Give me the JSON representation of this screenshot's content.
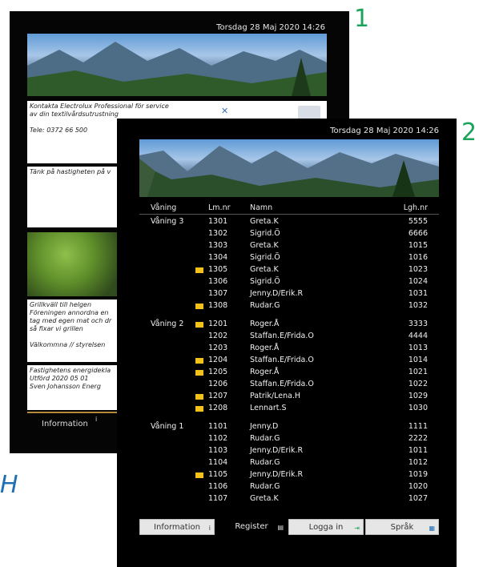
{
  "labels": {
    "one": "1",
    "two": "2",
    "side_letter": "H"
  },
  "screen1": {
    "datetime": "Torsdag 28 Maj 2020  14:26",
    "panel1": [
      "Kontakta Electrolux Professional för service",
      "av din textilvårdsutrustning",
      "",
      "Tele: 0372 66 500"
    ],
    "panel2": [
      "Tänk på hastigheten på v"
    ],
    "panel3": [
      "Grillkväll till helgen",
      "Föreningen annordna en",
      "tag med egen mat och dr",
      "så fixar vi grillen",
      "",
      "Välkommna  // styrelsen"
    ],
    "panel4": [
      "Fastighetens energidekla",
      "Utförd 2020 05 01",
      "Sven Johansson Energ"
    ],
    "info_button": "Information",
    "info_icon": "i"
  },
  "screen2": {
    "datetime": "Torsdag 28 Maj 2020  14:26",
    "headers": {
      "floor": "Våning",
      "lm": "Lm.nr",
      "name": "Namn",
      "lgh": "Lgh.nr"
    },
    "rows": [
      {
        "floor": "Våning 3",
        "mail": false,
        "lm": "1301",
        "name": "Greta.K",
        "lgh": "5555"
      },
      {
        "floor": "",
        "mail": false,
        "lm": "1302",
        "name": "Sigrid.Ö",
        "lgh": "6666"
      },
      {
        "floor": "",
        "mail": false,
        "lm": "1303",
        "name": "Greta.K",
        "lgh": "1015"
      },
      {
        "floor": "",
        "mail": false,
        "lm": "1304",
        "name": "Sigrid.Ö",
        "lgh": "1016"
      },
      {
        "floor": "",
        "mail": true,
        "lm": "1305",
        "name": "Greta.K",
        "lgh": "1023"
      },
      {
        "floor": "",
        "mail": false,
        "lm": "1306",
        "name": "Sigrid.Ö",
        "lgh": "1024"
      },
      {
        "floor": "",
        "mail": false,
        "lm": "1307",
        "name": "Jenny.D/Erik.R",
        "lgh": "1031"
      },
      {
        "floor": "",
        "mail": true,
        "lm": "1308",
        "name": "Rudar.G",
        "lgh": "1032"
      },
      {
        "floor": "Våning 2",
        "mail": true,
        "lm": "1201",
        "name": "Roger.Å",
        "lgh": "3333"
      },
      {
        "floor": "",
        "mail": false,
        "lm": "1202",
        "name": "Staffan.E/Frida.O",
        "lgh": "4444"
      },
      {
        "floor": "",
        "mail": false,
        "lm": "1203",
        "name": "Roger.Å",
        "lgh": "1013"
      },
      {
        "floor": "",
        "mail": true,
        "lm": "1204",
        "name": "Staffan.E/Frida.O",
        "lgh": "1014"
      },
      {
        "floor": "",
        "mail": true,
        "lm": "1205",
        "name": "Roger.Å",
        "lgh": "1021"
      },
      {
        "floor": "",
        "mail": false,
        "lm": "1206",
        "name": "Staffan.E/Frida.O",
        "lgh": "1022"
      },
      {
        "floor": "",
        "mail": true,
        "lm": "1207",
        "name": "Patrik/Lena.H",
        "lgh": "1029"
      },
      {
        "floor": "",
        "mail": true,
        "lm": "1208",
        "name": "Lennart.S",
        "lgh": "1030"
      },
      {
        "floor": "Våning 1",
        "mail": false,
        "lm": "1101",
        "name": "Jenny.D",
        "lgh": "1111"
      },
      {
        "floor": "",
        "mail": false,
        "lm": "1102",
        "name": "Rudar.G",
        "lgh": "2222"
      },
      {
        "floor": "",
        "mail": false,
        "lm": "1103",
        "name": "Jenny.D/Erik.R",
        "lgh": "1011"
      },
      {
        "floor": "",
        "mail": false,
        "lm": "1104",
        "name": "Rudar.G",
        "lgh": "1012"
      },
      {
        "floor": "",
        "mail": true,
        "lm": "1105",
        "name": "Jenny.D/Erik.R",
        "lgh": "1019"
      },
      {
        "floor": "",
        "mail": false,
        "lm": "1106",
        "name": "Rudar.G",
        "lgh": "1020"
      },
      {
        "floor": "",
        "mail": false,
        "lm": "1107",
        "name": "Greta.K",
        "lgh": "1027"
      }
    ],
    "footer": {
      "information": "Information",
      "register": "Register",
      "login": "Logga in",
      "language": "Språk",
      "info_icon": "i"
    }
  },
  "colors": {
    "green": "#1aa35a",
    "mail": "#f2c21b",
    "blue": "#1f6fb4"
  }
}
